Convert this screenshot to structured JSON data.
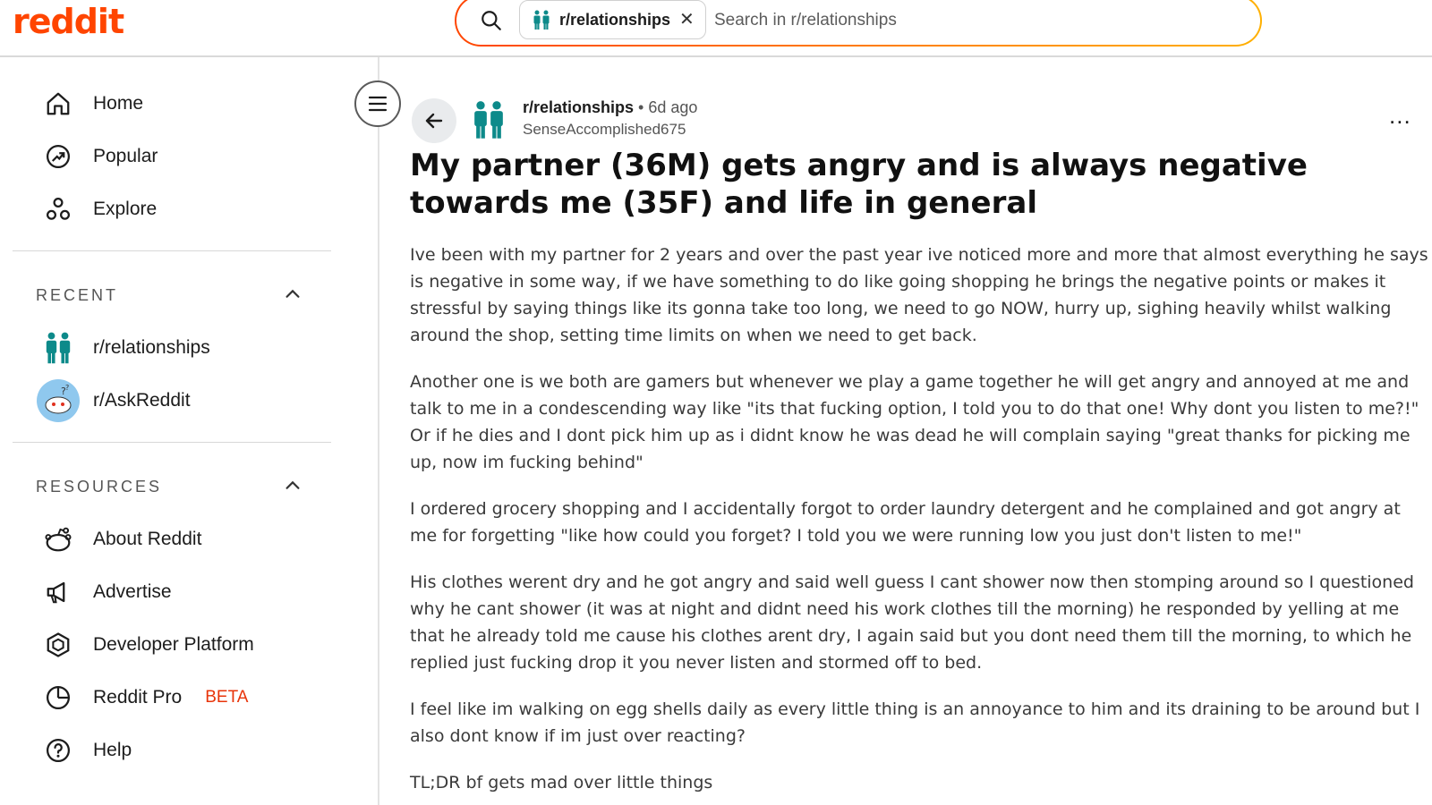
{
  "brand": {
    "logo_text": "reddit",
    "accent": "#ff4500"
  },
  "search": {
    "chip_label": "r/relationships",
    "placeholder": "Search in r/relationships"
  },
  "sidebar": {
    "nav": [
      {
        "label": "Home",
        "icon": "home-icon"
      },
      {
        "label": "Popular",
        "icon": "popular-icon"
      },
      {
        "label": "Explore",
        "icon": "explore-icon"
      }
    ],
    "recent_title": "RECENT",
    "recent": [
      {
        "label": "r/relationships",
        "icon": "relationships-community-icon"
      },
      {
        "label": "r/AskReddit",
        "icon": "askreddit-community-icon"
      }
    ],
    "resources_title": "RESOURCES",
    "resources": [
      {
        "label": "About Reddit",
        "icon": "reddit-alien-icon"
      },
      {
        "label": "Advertise",
        "icon": "megaphone-icon"
      },
      {
        "label": "Developer Platform",
        "icon": "developer-platform-icon"
      },
      {
        "label": "Reddit Pro",
        "badge": "BETA",
        "icon": "reddit-pro-icon"
      },
      {
        "label": "Help",
        "icon": "help-icon"
      }
    ]
  },
  "post": {
    "subreddit": "r/relationships",
    "separator": "•",
    "time": "6d ago",
    "author": "SenseAccomplished675",
    "more": "...",
    "title": "My partner (36M) gets angry and is always negative towards me (35F) and life in general",
    "paragraphs": [
      "Ive been with my partner for 2 years and over the past year ive noticed more and more that almost everything he says is negative in some way, if we have something to do like going shopping he brings the negative points or makes it stressful by saying things like its gonna take too long, we need to go NOW, hurry up, sighing heavily whilst walking around the shop, setting time limits on when we need to get back.",
      "Another one is we both are gamers but whenever we play a game together he will get angry and annoyed at me and talk to me in a condescending way like \"its that fucking option, I told you to do that one! Why dont you listen to me?!\" Or if he dies and I dont pick him up as i didnt know he was dead he will complain saying \"great thanks for picking me up, now im fucking behind\"",
      "I ordered grocery shopping and I accidentally forgot to order laundry detergent and he complained and got angry at me for forgetting \"like how could you forget? I told you we were running low you just don't listen to me!\"",
      "His clothes werent dry and he got angry and said well guess I cant shower now then stomping around so I questioned why he cant shower (it was at night and didnt need his work clothes till the morning) he responded by yelling at me that he already told me cause his clothes arent dry, I again said but you dont need them till the morning, to which he replied just fucking drop it you never listen and stormed off to bed.",
      "I feel like im walking on egg shells daily as every little thing is an annoyance to him and its draining to be around but I also dont know if im just over reacting?",
      "TL;DR bf gets mad over little things"
    ]
  }
}
